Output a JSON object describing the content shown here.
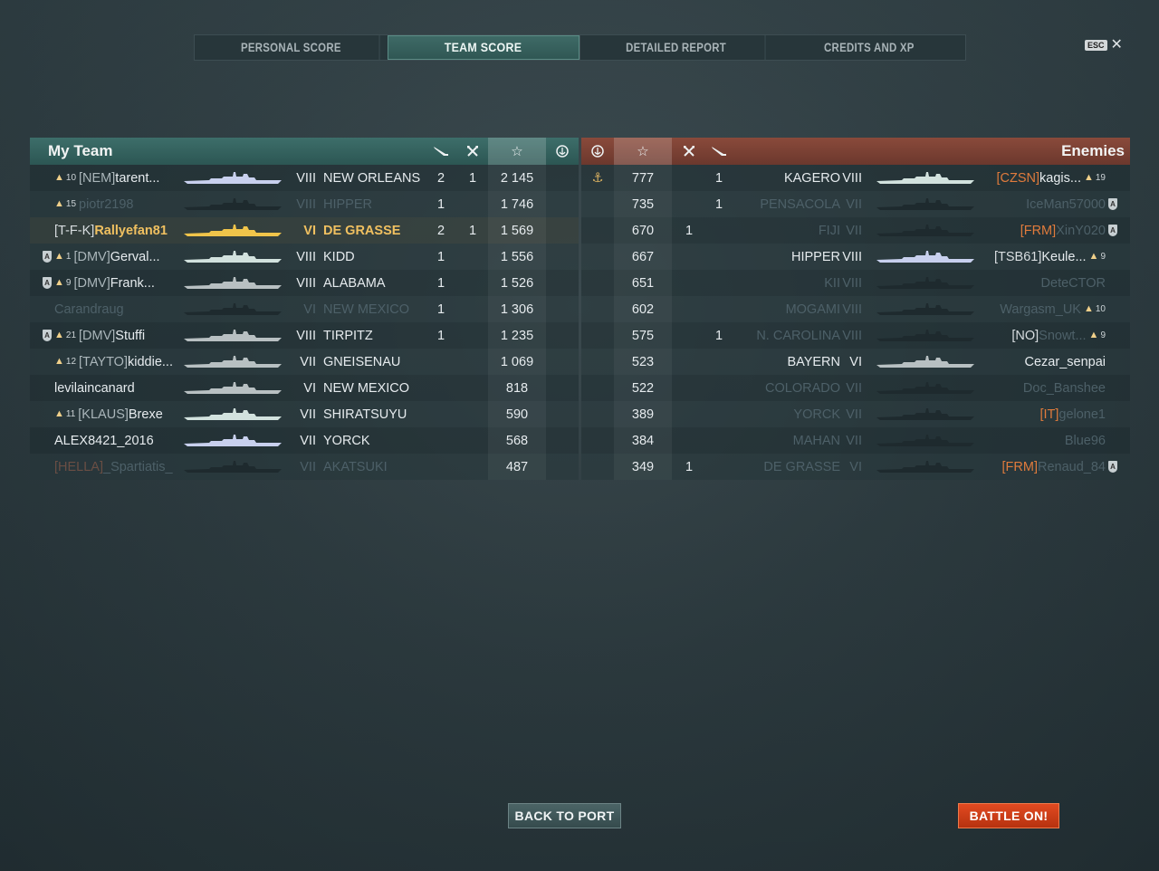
{
  "tabs": [
    "PERSONAL SCORE",
    "TEAM SCORE",
    "DETAILED REPORT",
    "CREDITS AND XP"
  ],
  "active_tab": "TEAM SCORE",
  "esc_label": "ESC",
  "close_label": "✕",
  "my_team": {
    "title": "My Team",
    "rows": [
      {
        "badge": "",
        "rank": "10",
        "clan": "[NEM]",
        "name": "tarent...",
        "tier": "VIII",
        "ship": "NEW ORLEANS",
        "planes": "2",
        "kills": "1",
        "score": "2 145",
        "base": "",
        "dead": false,
        "self": false,
        "ship_color": "#c8d0ee"
      },
      {
        "badge": "",
        "rank": "15",
        "clan": "",
        "name": "piotr2198",
        "tier": "VIII",
        "ship": "HIPPER",
        "planes": "1",
        "kills": "",
        "score": "1 746",
        "base": "",
        "dead": true,
        "self": false,
        "ship_color": "#1e2a2e"
      },
      {
        "badge": "",
        "rank": "",
        "clan": "[T-F-K]",
        "name": "Rallyefan81",
        "tier": "VI",
        "ship": "DE GRASSE",
        "planes": "2",
        "kills": "1",
        "score": "1 569",
        "base": "",
        "dead": false,
        "self": true,
        "ship_color": "#f0c44a"
      },
      {
        "badge": "A",
        "rank": "1",
        "clan": "[DMV]",
        "name": "Gerval...",
        "tier": "VIII",
        "ship": "KIDD",
        "planes": "1",
        "kills": "",
        "score": "1 556",
        "base": "",
        "dead": false,
        "self": false,
        "ship_color": "#d2e2de"
      },
      {
        "badge": "A",
        "rank": "9",
        "clan": "[DMV]",
        "name": "Frank...",
        "tier": "VIII",
        "ship": "ALABAMA",
        "planes": "1",
        "kills": "",
        "score": "1 526",
        "base": "",
        "dead": false,
        "self": false,
        "ship_color": "#b8c0c2"
      },
      {
        "badge": "",
        "rank": "",
        "clan": "",
        "name": "Carandraug",
        "tier": "VI",
        "ship": "NEW MEXICO",
        "planes": "1",
        "kills": "",
        "score": "1 306",
        "base": "",
        "dead": true,
        "self": false,
        "ship_color": "#1e2a2e"
      },
      {
        "badge": "A",
        "rank": "21",
        "clan": "[DMV]",
        "name": "Stuffi",
        "tier": "VIII",
        "ship": "TIRPITZ",
        "planes": "1",
        "kills": "",
        "score": "1 235",
        "base": "",
        "dead": false,
        "self": false,
        "ship_color": "#b8c0c2"
      },
      {
        "badge": "",
        "rank": "12",
        "clan": "[TAYTO]",
        "name": "kiddie...",
        "tier": "VII",
        "ship": "GNEISENAU",
        "planes": "",
        "kills": "",
        "score": "1 069",
        "base": "",
        "dead": false,
        "self": false,
        "ship_color": "#b8c0c2"
      },
      {
        "badge": "",
        "rank": "",
        "clan": "",
        "name": "levilaincanard",
        "tier": "VI",
        "ship": "NEW MEXICO",
        "planes": "",
        "kills": "",
        "score": "818",
        "base": "",
        "dead": false,
        "self": false,
        "ship_color": "#b8c0c2"
      },
      {
        "badge": "",
        "rank": "11",
        "clan": "[KLAUS]",
        "name": "Brexe",
        "tier": "VII",
        "ship": "SHIRATSUYU",
        "planes": "",
        "kills": "",
        "score": "590",
        "base": "",
        "dead": false,
        "self": false,
        "ship_color": "#d2e2de"
      },
      {
        "badge": "",
        "rank": "",
        "clan": "",
        "name": "ALEX8421_2016",
        "tier": "VII",
        "ship": "YORCK",
        "planes": "",
        "kills": "",
        "score": "568",
        "base": "",
        "dead": false,
        "self": false,
        "ship_color": "#c8d0ee"
      },
      {
        "badge": "",
        "rank": "",
        "clan": "[HELLA]",
        "name": "_Spartiatis_",
        "tier": "VII",
        "ship": "AKATSUKI",
        "planes": "",
        "kills": "",
        "score": "487",
        "base": "",
        "dead": true,
        "self": false,
        "ship_color": "#1e2a2e"
      }
    ]
  },
  "enemies": {
    "title": "Enemies",
    "rows": [
      {
        "base": "⚓",
        "score": "777",
        "kills": "",
        "planes": "1",
        "ship": "KAGERO",
        "tier": "VIII",
        "clan": "[CZSN]",
        "name": "kagis...",
        "rank": "19",
        "badge": "",
        "dead": false,
        "ship_color": "#d2e2de"
      },
      {
        "base": "",
        "score": "735",
        "kills": "",
        "planes": "1",
        "ship": "PENSACOLA",
        "tier": "VII",
        "clan": "",
        "name": "IceMan57000",
        "rank": "",
        "badge": "A",
        "dead": true,
        "ship_color": "#1e2a2e"
      },
      {
        "base": "",
        "score": "670",
        "kills": "1",
        "planes": "",
        "ship": "FIJI",
        "tier": "VII",
        "clan": "[FRM]",
        "name": "XinY020",
        "rank": "",
        "badge": "A",
        "dead": true,
        "ship_color": "#1e2a2e"
      },
      {
        "base": "",
        "score": "667",
        "kills": "",
        "planes": "",
        "ship": "HIPPER",
        "tier": "VIII",
        "clan": "[TSB61]",
        "name": "Keule...",
        "rank": "9",
        "badge": "",
        "dead": false,
        "ship_color": "#c8d0ee"
      },
      {
        "base": "",
        "score": "651",
        "kills": "",
        "planes": "",
        "ship": "KII",
        "tier": "VIII",
        "clan": "",
        "name": "DeteCTOR",
        "rank": "",
        "badge": "",
        "dead": true,
        "ship_color": "#1e2a2e"
      },
      {
        "base": "",
        "score": "602",
        "kills": "",
        "planes": "",
        "ship": "MOGAMI",
        "tier": "VIII",
        "clan": "",
        "name": "Wargasm_UK",
        "rank": "10",
        "badge": "",
        "dead": true,
        "ship_color": "#1e2a2e"
      },
      {
        "base": "",
        "score": "575",
        "kills": "",
        "planes": "1",
        "ship": "N. CAROLINA",
        "tier": "VIII",
        "clan": "[NO]",
        "name": "Snowt...",
        "rank": "9",
        "badge": "",
        "dead": true,
        "ship_color": "#1e2a2e"
      },
      {
        "base": "",
        "score": "523",
        "kills": "",
        "planes": "",
        "ship": "BAYERN",
        "tier": "VI",
        "clan": "",
        "name": "Cezar_senpai",
        "rank": "",
        "badge": "",
        "dead": false,
        "ship_color": "#b8c0c2"
      },
      {
        "base": "",
        "score": "522",
        "kills": "",
        "planes": "",
        "ship": "COLORADO",
        "tier": "VII",
        "clan": "",
        "name": "Doc_Banshee",
        "rank": "",
        "badge": "",
        "dead": true,
        "ship_color": "#1e2a2e"
      },
      {
        "base": "",
        "score": "389",
        "kills": "",
        "planes": "",
        "ship": "YORCK",
        "tier": "VII",
        "clan": "[IT]",
        "name": "gelone1",
        "rank": "",
        "badge": "",
        "dead": true,
        "ship_color": "#1e2a2e"
      },
      {
        "base": "",
        "score": "384",
        "kills": "",
        "planes": "",
        "ship": "MAHAN",
        "tier": "VII",
        "clan": "",
        "name": "Blue96",
        "rank": "",
        "badge": "",
        "dead": true,
        "ship_color": "#1e2a2e"
      },
      {
        "base": "",
        "score": "349",
        "kills": "1",
        "planes": "",
        "ship": "DE GRASSE",
        "tier": "VI",
        "clan": "[FRM]",
        "name": "Renaud_84",
        "rank": "",
        "badge": "A",
        "dead": true,
        "ship_color": "#1e2a2e"
      }
    ]
  },
  "buttons": {
    "back": "BACK TO PORT",
    "battle": "BATTLE ON!"
  },
  "colors": {
    "accent_team": "#3d6e6a",
    "accent_enemy": "#8a4a3b",
    "self_player": "#f0c060",
    "clan_orange": "#e07b3c",
    "battle_button": "#e24a21"
  }
}
